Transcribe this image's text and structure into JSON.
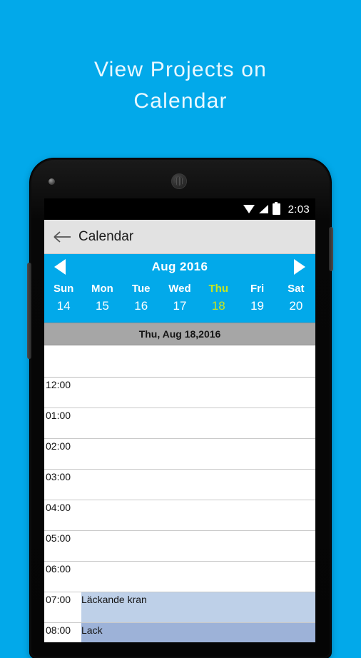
{
  "promo": {
    "headline": "View Projects on\nCalendar",
    "background_color": "#02a9ea"
  },
  "statusbar": {
    "time": "2:03",
    "icons": [
      "wifi-icon",
      "signal-icon",
      "battery-icon"
    ]
  },
  "actionbar": {
    "back_icon": "back-arrow-icon",
    "title": "Calendar"
  },
  "calendar": {
    "accent_color": "#02a9ea",
    "selected_color": "#c8e61e",
    "prev_icon": "triangle-left-icon",
    "next_icon": "triangle-right-icon",
    "month_label": "Aug 2016",
    "week": [
      {
        "name": "Sun",
        "num": "14",
        "selected": false
      },
      {
        "name": "Mon",
        "num": "15",
        "selected": false
      },
      {
        "name": "Tue",
        "num": "16",
        "selected": false
      },
      {
        "name": "Wed",
        "num": "17",
        "selected": false
      },
      {
        "name": "Thu",
        "num": "18",
        "selected": true
      },
      {
        "name": "Fri",
        "num": "19",
        "selected": false
      },
      {
        "name": "Sat",
        "num": "20",
        "selected": false
      }
    ],
    "date_banner": "Thu, Aug 18,2016",
    "time_slots": [
      {
        "label": "12:00",
        "event": ""
      },
      {
        "label": "01:00",
        "event": ""
      },
      {
        "label": "02:00",
        "event": ""
      },
      {
        "label": "03:00",
        "event": ""
      },
      {
        "label": "04:00",
        "event": ""
      },
      {
        "label": "05:00",
        "event": ""
      },
      {
        "label": "06:00",
        "event": ""
      },
      {
        "label": "07:00",
        "event": "Läckande kran"
      },
      {
        "label": "08:00",
        "event": "Lack"
      }
    ]
  }
}
